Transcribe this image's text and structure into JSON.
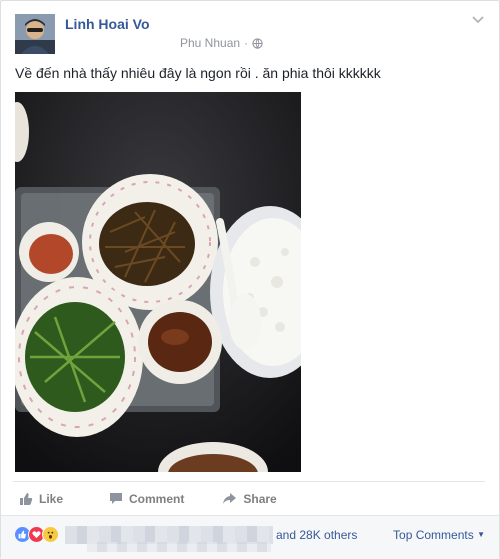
{
  "post": {
    "author": "Linh Hoai Vo",
    "location": "Phu Nhuan",
    "privacy_icon": "globe-icon",
    "text": "Về đến nhà thấy nhiêu đây là ngon rồi . ăn phia thôi kkkkkk"
  },
  "actions": {
    "like": "Like",
    "comment": "Comment",
    "share": "Share"
  },
  "reactions": {
    "icons": [
      "like-reaction-icon",
      "love-reaction-icon",
      "wow-reaction-icon"
    ],
    "colors": {
      "like": "#5890ff",
      "love": "#f0384f",
      "wow": "#f7c941"
    },
    "summary": "and 28K others",
    "sort_label": "Top Comments"
  },
  "colors": {
    "link": "#365899",
    "muted": "#90949c",
    "action": "#7f7f7f"
  }
}
